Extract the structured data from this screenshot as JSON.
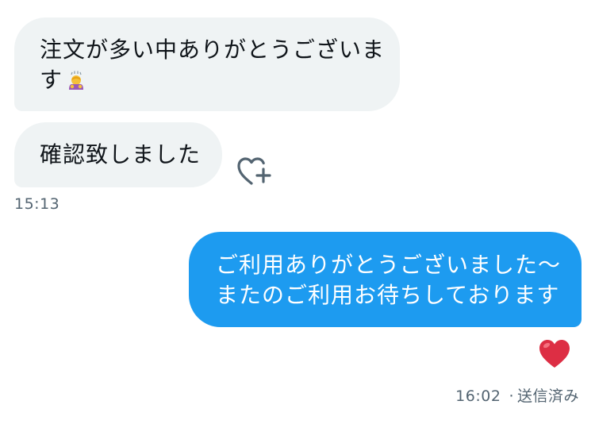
{
  "conversation": {
    "incoming": [
      {
        "lines": [
          "注文が多い中ありがとうございま",
          "す"
        ],
        "emoji": "person-bowing-emoji"
      },
      {
        "lines": [
          "確認致しました"
        ]
      }
    ],
    "incoming_time": "15:13",
    "outgoing": {
      "lines": [
        "ご利用ありがとうございました〜",
        "またのご利用お待ちしております"
      ],
      "reaction": "red-heart-emoji"
    },
    "outgoing_time": "16:02",
    "outgoing_status": "送信済み",
    "status_separator": "·"
  },
  "icons": {
    "add_reaction": "heart-plus-icon"
  },
  "colors": {
    "incoming_bubble": "#eff3f4",
    "outgoing_bubble": "#1d9bf0",
    "meta_text": "#536471",
    "reaction_heart": "#e0245e"
  }
}
